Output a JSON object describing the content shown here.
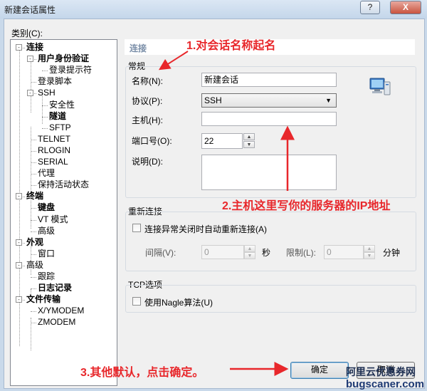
{
  "window": {
    "title": "新建会话属性",
    "help_label": "?",
    "close_label": "X"
  },
  "tree": {
    "label": "类别(C):",
    "items": [
      {
        "label": "连接",
        "bold": true
      },
      {
        "label": "用户身份验证",
        "bold": true
      },
      {
        "label": "登录提示符",
        "bold": false
      },
      {
        "label": "登录脚本",
        "bold": false
      },
      {
        "label": "SSH",
        "bold": false
      },
      {
        "label": "安全性",
        "bold": false
      },
      {
        "label": "隧道",
        "bold": true
      },
      {
        "label": "SFTP",
        "bold": false
      },
      {
        "label": "TELNET",
        "bold": false
      },
      {
        "label": "RLOGIN",
        "bold": false
      },
      {
        "label": "SERIAL",
        "bold": false
      },
      {
        "label": "代理",
        "bold": false
      },
      {
        "label": "保持活动状态",
        "bold": false
      },
      {
        "label": "终端",
        "bold": true
      },
      {
        "label": "键盘",
        "bold": true
      },
      {
        "label": "VT 模式",
        "bold": false
      },
      {
        "label": "高级",
        "bold": false
      },
      {
        "label": "外观",
        "bold": true
      },
      {
        "label": "窗口",
        "bold": false
      },
      {
        "label": "高级",
        "bold": false
      },
      {
        "label": "跟踪",
        "bold": false
      },
      {
        "label": "日志记录",
        "bold": true
      },
      {
        "label": "文件传输",
        "bold": true
      },
      {
        "label": "X/YMODEM",
        "bold": false
      },
      {
        "label": "ZMODEM",
        "bold": false
      }
    ]
  },
  "panel": {
    "header": "连接",
    "general": {
      "title": "常规",
      "name_label": "名称(N):",
      "name_value": "新建会话",
      "protocol_label": "协议(P):",
      "protocol_value": "SSH",
      "host_label": "主机(H):",
      "host_value": "",
      "port_label": "端口号(O):",
      "port_value": "22",
      "desc_label": "说明(D):",
      "desc_value": ""
    },
    "reconnect": {
      "title": "重新连接",
      "checkbox_label": "连接异常关闭时自动重新连接(A)",
      "interval_label": "间隔(V):",
      "interval_value": "0",
      "interval_unit": "秒",
      "limit_label": "限制(L):",
      "limit_value": "0",
      "limit_unit": "分钟"
    },
    "tcp": {
      "title": "TCP选项",
      "nagle_label": "使用Nagle算法(U)"
    }
  },
  "buttons": {
    "ok": "确定",
    "cancel": "取消"
  },
  "annotations": {
    "a1": "1.对会话名称起名",
    "a2": "2.主机这里写你的服务器的IP地址",
    "a3": "3.其他默认，点击确定。",
    "color": "#e8272b"
  },
  "watermark": {
    "line1": "阿里云优惠券网",
    "line2": "bugscaner.com"
  }
}
